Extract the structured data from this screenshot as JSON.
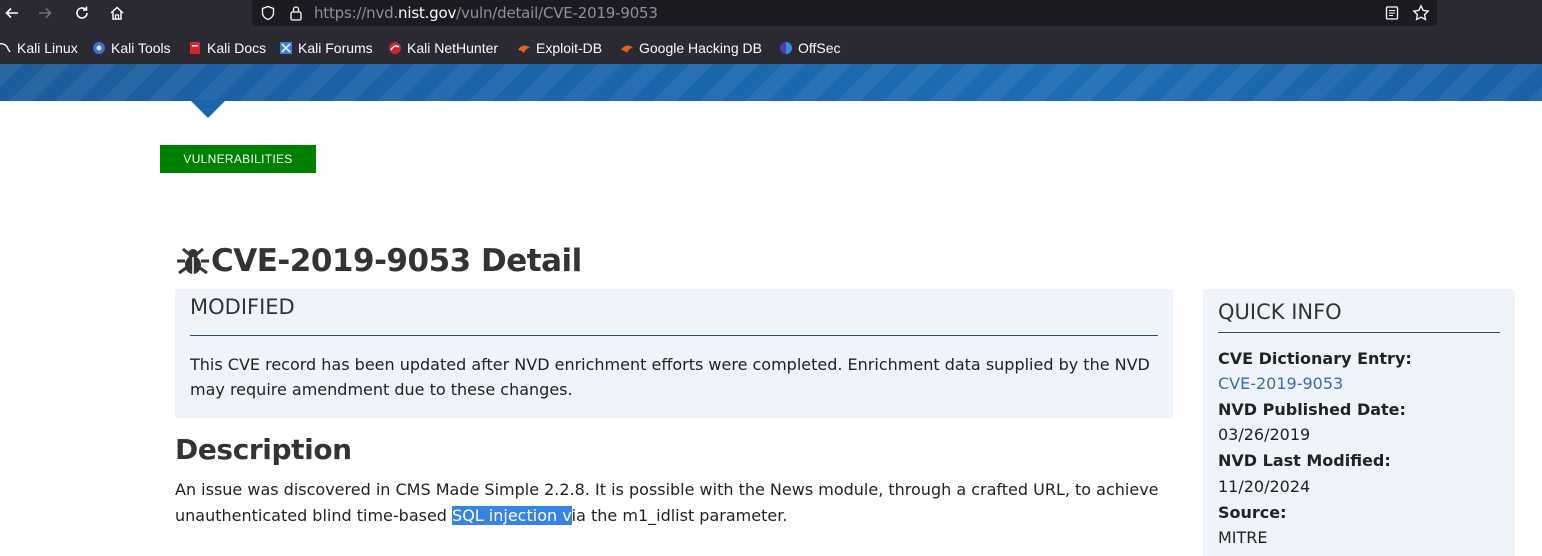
{
  "browser": {
    "url_prefix": "https://nvd.",
    "url_domain": "nist.gov",
    "url_path": "/vuln/detail/CVE-2019-9053"
  },
  "bookmarks": [
    {
      "label": "Kali Linux",
      "icon": "kali-dragon-icon"
    },
    {
      "label": "Kali Tools",
      "icon": "kali-tools-icon"
    },
    {
      "label": "Kali Docs",
      "icon": "kali-docs-icon"
    },
    {
      "label": "Kali Forums",
      "icon": "kali-forums-icon"
    },
    {
      "label": "Kali NetHunter",
      "icon": "kali-nethunter-icon"
    },
    {
      "label": "Exploit-DB",
      "icon": "exploit-db-icon"
    },
    {
      "label": "Google Hacking DB",
      "icon": "ghdb-icon"
    },
    {
      "label": "OffSec",
      "icon": "offsec-icon"
    }
  ],
  "nav": {
    "vulnerabilities_label": "VULNERABILITIES"
  },
  "page": {
    "title": "CVE-2019-9053 Detail"
  },
  "modified": {
    "heading": "MODIFIED",
    "text": "This CVE record has been updated after NVD enrichment efforts were completed. Enrichment data supplied by the NVD may require amendment due to these changes."
  },
  "description": {
    "heading": "Description",
    "text_before": "An issue was discovered in CMS Made Simple 2.2.8. It is possible with the News module, through a crafted URL, to achieve unauthenticated blind time-based ",
    "text_selected": "SQL injection v",
    "text_after": "ia the m1_idlist parameter."
  },
  "quick_info": {
    "heading": "QUICK INFO",
    "cve_entry_label": "CVE Dictionary Entry:",
    "cve_entry_value": "CVE-2019-9053",
    "published_label": "NVD Published Date:",
    "published_value": "03/26/2019",
    "modified_label": "NVD Last Modified:",
    "modified_value": "11/20/2024",
    "source_label": "Source:",
    "source_value": "MITRE"
  },
  "colors": {
    "browser_chrome": "#2b2a33",
    "banner_blue": "#1a66ad",
    "vuln_green": "#008000",
    "panel_bg": "#eef4fa",
    "link_blue": "#3a6ea5",
    "selection": "#3584e4"
  }
}
